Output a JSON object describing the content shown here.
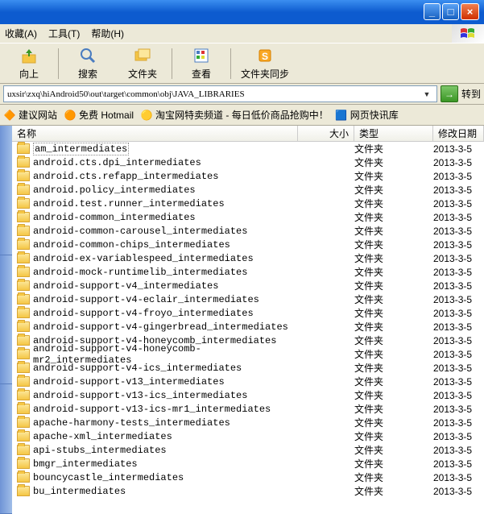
{
  "menu": {
    "fav": "收藏(A)",
    "tools": "工具(T)",
    "help": "帮助(H)"
  },
  "toolbar": {
    "up": "向上",
    "search": "搜索",
    "folders": "文件夹",
    "view": "查看",
    "sync": "文件夹同步"
  },
  "address": {
    "path": "uxsir\\zxq\\hiAndroid50\\out\\target\\common\\obj\\JAVA_LIBRARIES",
    "go": "转到"
  },
  "links": {
    "suggest": "建议网站",
    "hotmail": "免费 Hotmail",
    "taobao": "淘宝网特卖频道 - 每日低价商品抢购中！",
    "quick": "网页快讯库"
  },
  "columns": {
    "name": "名称",
    "size": "大小",
    "type": "类型",
    "date": "修改日期"
  },
  "rows": [
    {
      "name": "am_intermediates",
      "type": "文件夹",
      "date": "2013-3-5",
      "selected": true
    },
    {
      "name": "android.cts.dpi_intermediates",
      "type": "文件夹",
      "date": "2013-3-5"
    },
    {
      "name": "android.cts.refapp_intermediates",
      "type": "文件夹",
      "date": "2013-3-5"
    },
    {
      "name": "android.policy_intermediates",
      "type": "文件夹",
      "date": "2013-3-5"
    },
    {
      "name": "android.test.runner_intermediates",
      "type": "文件夹",
      "date": "2013-3-5"
    },
    {
      "name": "android-common_intermediates",
      "type": "文件夹",
      "date": "2013-3-5"
    },
    {
      "name": "android-common-carousel_intermediates",
      "type": "文件夹",
      "date": "2013-3-5"
    },
    {
      "name": "android-common-chips_intermediates",
      "type": "文件夹",
      "date": "2013-3-5"
    },
    {
      "name": "android-ex-variablespeed_intermediates",
      "type": "文件夹",
      "date": "2013-3-5"
    },
    {
      "name": "android-mock-runtimelib_intermediates",
      "type": "文件夹",
      "date": "2013-3-5"
    },
    {
      "name": "android-support-v4_intermediates",
      "type": "文件夹",
      "date": "2013-3-5"
    },
    {
      "name": "android-support-v4-eclair_intermediates",
      "type": "文件夹",
      "date": "2013-3-5"
    },
    {
      "name": "android-support-v4-froyo_intermediates",
      "type": "文件夹",
      "date": "2013-3-5"
    },
    {
      "name": "android-support-v4-gingerbread_intermediates",
      "type": "文件夹",
      "date": "2013-3-5"
    },
    {
      "name": "android-support-v4-honeycomb_intermediates",
      "type": "文件夹",
      "date": "2013-3-5"
    },
    {
      "name": "android-support-v4-honeycomb-mr2_intermediates",
      "type": "文件夹",
      "date": "2013-3-5"
    },
    {
      "name": "android-support-v4-ics_intermediates",
      "type": "文件夹",
      "date": "2013-3-5"
    },
    {
      "name": "android-support-v13_intermediates",
      "type": "文件夹",
      "date": "2013-3-5"
    },
    {
      "name": "android-support-v13-ics_intermediates",
      "type": "文件夹",
      "date": "2013-3-5"
    },
    {
      "name": "android-support-v13-ics-mr1_intermediates",
      "type": "文件夹",
      "date": "2013-3-5"
    },
    {
      "name": "apache-harmony-tests_intermediates",
      "type": "文件夹",
      "date": "2013-3-5"
    },
    {
      "name": "apache-xml_intermediates",
      "type": "文件夹",
      "date": "2013-3-5"
    },
    {
      "name": "api-stubs_intermediates",
      "type": "文件夹",
      "date": "2013-3-5"
    },
    {
      "name": "bmgr_intermediates",
      "type": "文件夹",
      "date": "2013-3-5"
    },
    {
      "name": "bouncycastle_intermediates",
      "type": "文件夹",
      "date": "2013-3-5"
    },
    {
      "name": "bu_intermediates",
      "type": "文件夹",
      "date": "2013-3-5"
    }
  ]
}
